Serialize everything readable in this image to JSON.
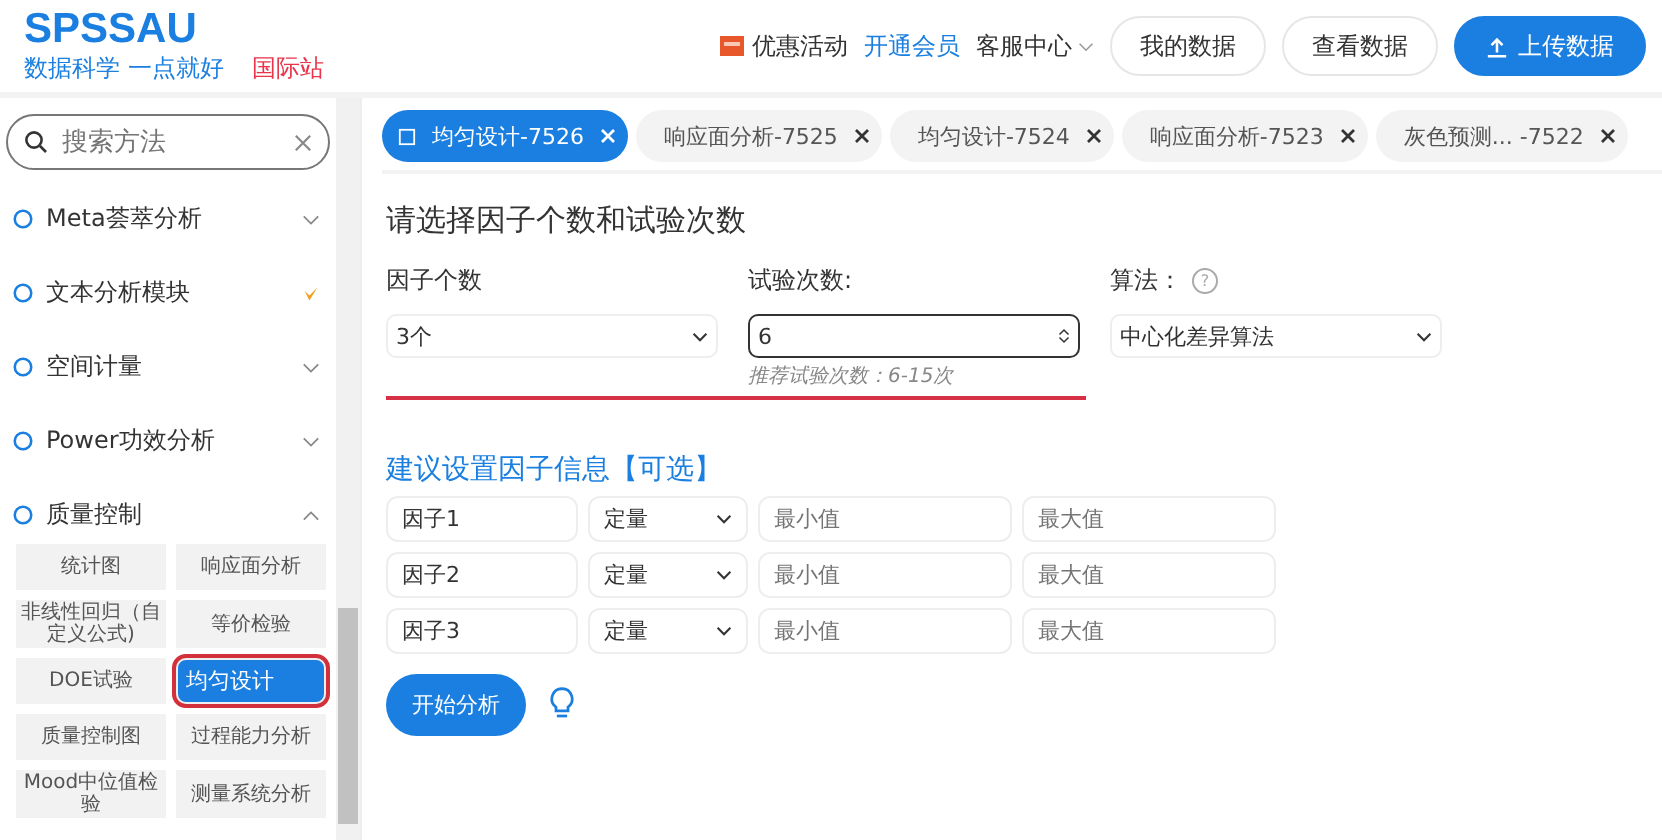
{
  "header": {
    "logo": "SPSSAU",
    "tagline": "数据科学 一点就好",
    "intl_link": "国际站",
    "nav": [
      {
        "label": "优惠活动",
        "kind": "promo"
      },
      {
        "label": "开通会员",
        "kind": "highlight"
      },
      {
        "label": "客服中心",
        "kind": "dropdown"
      }
    ],
    "buttons": [
      {
        "label": "我的数据",
        "kind": "outline"
      },
      {
        "label": "查看数据",
        "kind": "outline"
      },
      {
        "label": "上传数据",
        "kind": "primary"
      }
    ]
  },
  "sidebar": {
    "search": {
      "placeholder": "搜索方法"
    },
    "items": [
      {
        "label": "Meta荟萃分析",
        "kind": "chevron",
        "expanded": false
      },
      {
        "label": "文本分析模块",
        "kind": "new-mark"
      },
      {
        "label": "空间计量",
        "kind": "chevron",
        "expanded": false
      },
      {
        "label": "Power功效分析",
        "kind": "chevron",
        "expanded": false
      },
      {
        "label": "质量控制",
        "kind": "chevron",
        "expanded": true,
        "children": [
          {
            "label": "统计图",
            "selected": false
          },
          {
            "label": "响应面分析",
            "selected": false
          },
          {
            "label": "非线性回归（自定义公式)",
            "selected": false
          },
          {
            "label": "等价检验",
            "selected": false
          },
          {
            "label": "DOE试验",
            "selected": false
          },
          {
            "label": "均匀设计",
            "selected": true
          },
          {
            "label": "质量控制图",
            "selected": false
          },
          {
            "label": "过程能力分析",
            "selected": false
          },
          {
            "label": "Mood中位值检验",
            "selected": false
          },
          {
            "label": "测量系统分析",
            "selected": false
          }
        ]
      }
    ]
  },
  "tabs": [
    {
      "label": "均匀设计-7526",
      "selected": true
    },
    {
      "label": "响应面分析-7525",
      "selected": false
    },
    {
      "label": "均匀设计-7524",
      "selected": false
    },
    {
      "label": "响应面分析-7523",
      "selected": false
    },
    {
      "label": "灰色预测... -7522",
      "selected": false
    }
  ],
  "form": {
    "title": "请选择因子个数和试验次数",
    "factor_count": {
      "label": "因子个数",
      "value": "3个"
    },
    "trials": {
      "label": "试验次数:",
      "value": "6",
      "hint": "推荐试验次数：6-15次"
    },
    "algorithm": {
      "label": "算法：",
      "help": "?",
      "value": "中心化差异算法"
    },
    "section_title": "建议设置因子信息【可选】",
    "factors": [
      {
        "name": "因子1",
        "type": "定量",
        "min_placeholder": "最小值",
        "max_placeholder": "最大值"
      },
      {
        "name": "因子2",
        "type": "定量",
        "min_placeholder": "最小值",
        "max_placeholder": "最大值"
      },
      {
        "name": "因子3",
        "type": "定量",
        "min_placeholder": "最小值",
        "max_placeholder": "最大值"
      }
    ],
    "submit": "开始分析"
  }
}
